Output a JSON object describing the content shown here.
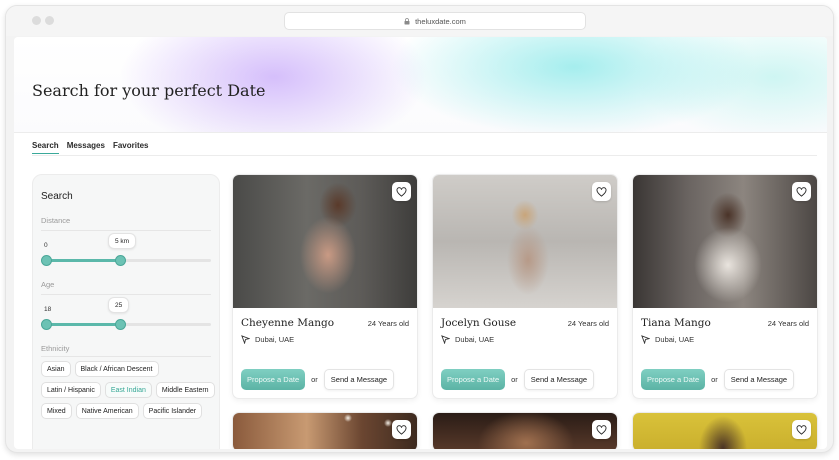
{
  "browser": {
    "url": "theluxdate.com"
  },
  "page": {
    "title": "Search for your perfect Date"
  },
  "tabs": [
    {
      "label": "Search",
      "active": true
    },
    {
      "label": "Messages",
      "active": false
    },
    {
      "label": "Favorites",
      "active": false
    }
  ],
  "sidebar": {
    "title": "Search",
    "distance": {
      "label": "Distance",
      "min_label": "0",
      "value_label": "5 km",
      "fill_fraction": 0.45
    },
    "age": {
      "label": "Age",
      "min_label": "18",
      "value_label": "25",
      "fill_fraction": 0.45
    },
    "ethnicity": {
      "label": "Ethnicity",
      "options": [
        "Asian",
        "Black / African Descent",
        "Latin / Hispanic",
        "East Indian",
        "Middle Eastern",
        "Mixed",
        "Native American",
        "Pacific Islander"
      ],
      "selected": "East Indian"
    }
  },
  "profiles": [
    {
      "name": "Cheyenne Mango",
      "age": "24 Years old",
      "location": "Dubai, UAE",
      "propose_label": "Propose a Date",
      "or_label": "or",
      "message_label": "Send a Message"
    },
    {
      "name": "Jocelyn Gouse",
      "age": "24 Years old",
      "location": "Dubai, UAE",
      "propose_label": "Propose a Date",
      "or_label": "or",
      "message_label": "Send a Message"
    },
    {
      "name": "Tiana Mango",
      "age": "24 Years old",
      "location": "Dubai, UAE",
      "propose_label": "Propose a Date",
      "or_label": "or",
      "message_label": "Send a Message"
    }
  ],
  "colors": {
    "accent": "#5bb8aa",
    "selected_chip_text": "#35a795"
  },
  "icons": {
    "heart": "heart-icon",
    "location": "navigation-arrow-icon",
    "lock": "lock-icon"
  }
}
